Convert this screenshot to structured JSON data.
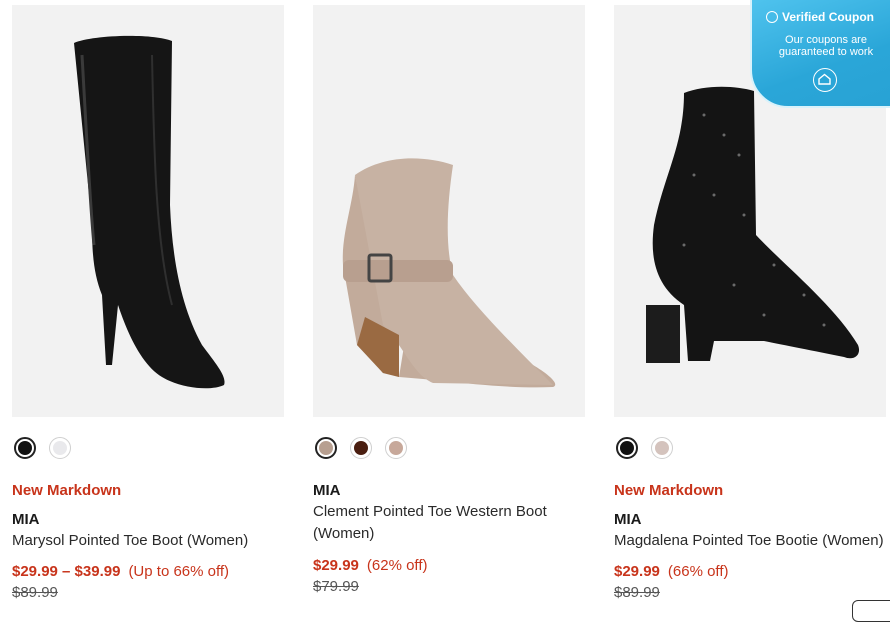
{
  "products": [
    {
      "badge": "New Markdown",
      "brand": "MIA",
      "name": "Marysol Pointed Toe Boot (Women)",
      "price_now": "$29.99 – $39.99",
      "discount": "(Up to 66% off)",
      "price_was": "$89.99",
      "swatches": [
        {
          "color": "#111111",
          "selected": true
        },
        {
          "color": "#e9e9ec",
          "selected": false
        }
      ]
    },
    {
      "badge": "",
      "brand": "MIA",
      "name": "Clement Pointed Toe Western Boot (Women)",
      "price_now": "$29.99",
      "discount": "(62% off)",
      "price_was": "$79.99",
      "swatches": [
        {
          "color": "#b79f90",
          "selected": true
        },
        {
          "color": "#4a1e10",
          "selected": false
        },
        {
          "color": "#c7a89a",
          "selected": false
        }
      ]
    },
    {
      "badge": "New Markdown",
      "brand": "MIA",
      "name": "Magdalena Pointed Toe Bootie (Women)",
      "price_now": "$29.99",
      "discount": "(66% off)",
      "price_was": "$89.99",
      "swatches": [
        {
          "color": "#111111",
          "selected": true
        },
        {
          "color": "#d4c3bd",
          "selected": false
        }
      ]
    }
  ],
  "coupon": {
    "title": "Verified Coupon",
    "subtitle": "Our coupons are guaranteed to work"
  },
  "colors": {
    "sale_red": "#c8341b",
    "image_bg": "#f2f2f2",
    "coupon_blue": "#3ab6e0"
  }
}
